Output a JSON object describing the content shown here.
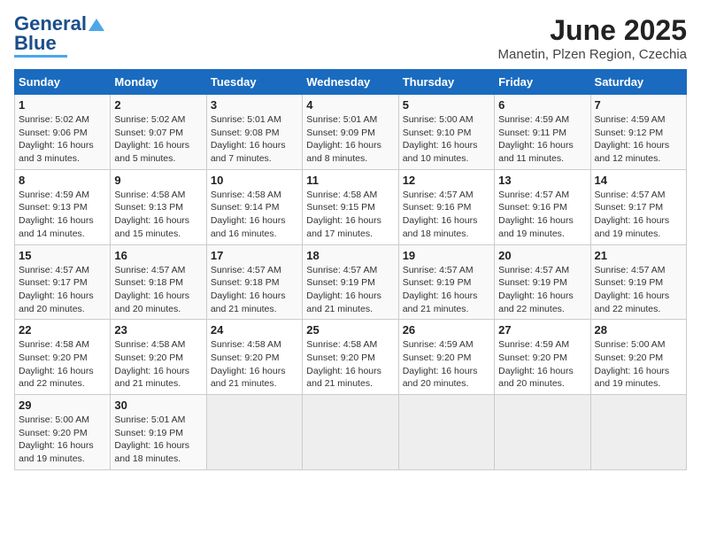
{
  "logo": {
    "line1": "General",
    "line2": "Blue"
  },
  "title": "June 2025",
  "subtitle": "Manetin, Plzen Region, Czechia",
  "weekdays": [
    "Sunday",
    "Monday",
    "Tuesday",
    "Wednesday",
    "Thursday",
    "Friday",
    "Saturday"
  ],
  "weeks": [
    [
      {
        "day": "1",
        "info": "Sunrise: 5:02 AM\nSunset: 9:06 PM\nDaylight: 16 hours\nand 3 minutes."
      },
      {
        "day": "2",
        "info": "Sunrise: 5:02 AM\nSunset: 9:07 PM\nDaylight: 16 hours\nand 5 minutes."
      },
      {
        "day": "3",
        "info": "Sunrise: 5:01 AM\nSunset: 9:08 PM\nDaylight: 16 hours\nand 7 minutes."
      },
      {
        "day": "4",
        "info": "Sunrise: 5:01 AM\nSunset: 9:09 PM\nDaylight: 16 hours\nand 8 minutes."
      },
      {
        "day": "5",
        "info": "Sunrise: 5:00 AM\nSunset: 9:10 PM\nDaylight: 16 hours\nand 10 minutes."
      },
      {
        "day": "6",
        "info": "Sunrise: 4:59 AM\nSunset: 9:11 PM\nDaylight: 16 hours\nand 11 minutes."
      },
      {
        "day": "7",
        "info": "Sunrise: 4:59 AM\nSunset: 9:12 PM\nDaylight: 16 hours\nand 12 minutes."
      }
    ],
    [
      {
        "day": "8",
        "info": "Sunrise: 4:59 AM\nSunset: 9:13 PM\nDaylight: 16 hours\nand 14 minutes."
      },
      {
        "day": "9",
        "info": "Sunrise: 4:58 AM\nSunset: 9:13 PM\nDaylight: 16 hours\nand 15 minutes."
      },
      {
        "day": "10",
        "info": "Sunrise: 4:58 AM\nSunset: 9:14 PM\nDaylight: 16 hours\nand 16 minutes."
      },
      {
        "day": "11",
        "info": "Sunrise: 4:58 AM\nSunset: 9:15 PM\nDaylight: 16 hours\nand 17 minutes."
      },
      {
        "day": "12",
        "info": "Sunrise: 4:57 AM\nSunset: 9:16 PM\nDaylight: 16 hours\nand 18 minutes."
      },
      {
        "day": "13",
        "info": "Sunrise: 4:57 AM\nSunset: 9:16 PM\nDaylight: 16 hours\nand 19 minutes."
      },
      {
        "day": "14",
        "info": "Sunrise: 4:57 AM\nSunset: 9:17 PM\nDaylight: 16 hours\nand 19 minutes."
      }
    ],
    [
      {
        "day": "15",
        "info": "Sunrise: 4:57 AM\nSunset: 9:17 PM\nDaylight: 16 hours\nand 20 minutes."
      },
      {
        "day": "16",
        "info": "Sunrise: 4:57 AM\nSunset: 9:18 PM\nDaylight: 16 hours\nand 20 minutes."
      },
      {
        "day": "17",
        "info": "Sunrise: 4:57 AM\nSunset: 9:18 PM\nDaylight: 16 hours\nand 21 minutes."
      },
      {
        "day": "18",
        "info": "Sunrise: 4:57 AM\nSunset: 9:19 PM\nDaylight: 16 hours\nand 21 minutes."
      },
      {
        "day": "19",
        "info": "Sunrise: 4:57 AM\nSunset: 9:19 PM\nDaylight: 16 hours\nand 21 minutes."
      },
      {
        "day": "20",
        "info": "Sunrise: 4:57 AM\nSunset: 9:19 PM\nDaylight: 16 hours\nand 22 minutes."
      },
      {
        "day": "21",
        "info": "Sunrise: 4:57 AM\nSunset: 9:19 PM\nDaylight: 16 hours\nand 22 minutes."
      }
    ],
    [
      {
        "day": "22",
        "info": "Sunrise: 4:58 AM\nSunset: 9:20 PM\nDaylight: 16 hours\nand 22 minutes."
      },
      {
        "day": "23",
        "info": "Sunrise: 4:58 AM\nSunset: 9:20 PM\nDaylight: 16 hours\nand 21 minutes."
      },
      {
        "day": "24",
        "info": "Sunrise: 4:58 AM\nSunset: 9:20 PM\nDaylight: 16 hours\nand 21 minutes."
      },
      {
        "day": "25",
        "info": "Sunrise: 4:58 AM\nSunset: 9:20 PM\nDaylight: 16 hours\nand 21 minutes."
      },
      {
        "day": "26",
        "info": "Sunrise: 4:59 AM\nSunset: 9:20 PM\nDaylight: 16 hours\nand 20 minutes."
      },
      {
        "day": "27",
        "info": "Sunrise: 4:59 AM\nSunset: 9:20 PM\nDaylight: 16 hours\nand 20 minutes."
      },
      {
        "day": "28",
        "info": "Sunrise: 5:00 AM\nSunset: 9:20 PM\nDaylight: 16 hours\nand 19 minutes."
      }
    ],
    [
      {
        "day": "29",
        "info": "Sunrise: 5:00 AM\nSunset: 9:20 PM\nDaylight: 16 hours\nand 19 minutes."
      },
      {
        "day": "30",
        "info": "Sunrise: 5:01 AM\nSunset: 9:19 PM\nDaylight: 16 hours\nand 18 minutes."
      },
      {
        "day": "",
        "info": ""
      },
      {
        "day": "",
        "info": ""
      },
      {
        "day": "",
        "info": ""
      },
      {
        "day": "",
        "info": ""
      },
      {
        "day": "",
        "info": ""
      }
    ]
  ]
}
